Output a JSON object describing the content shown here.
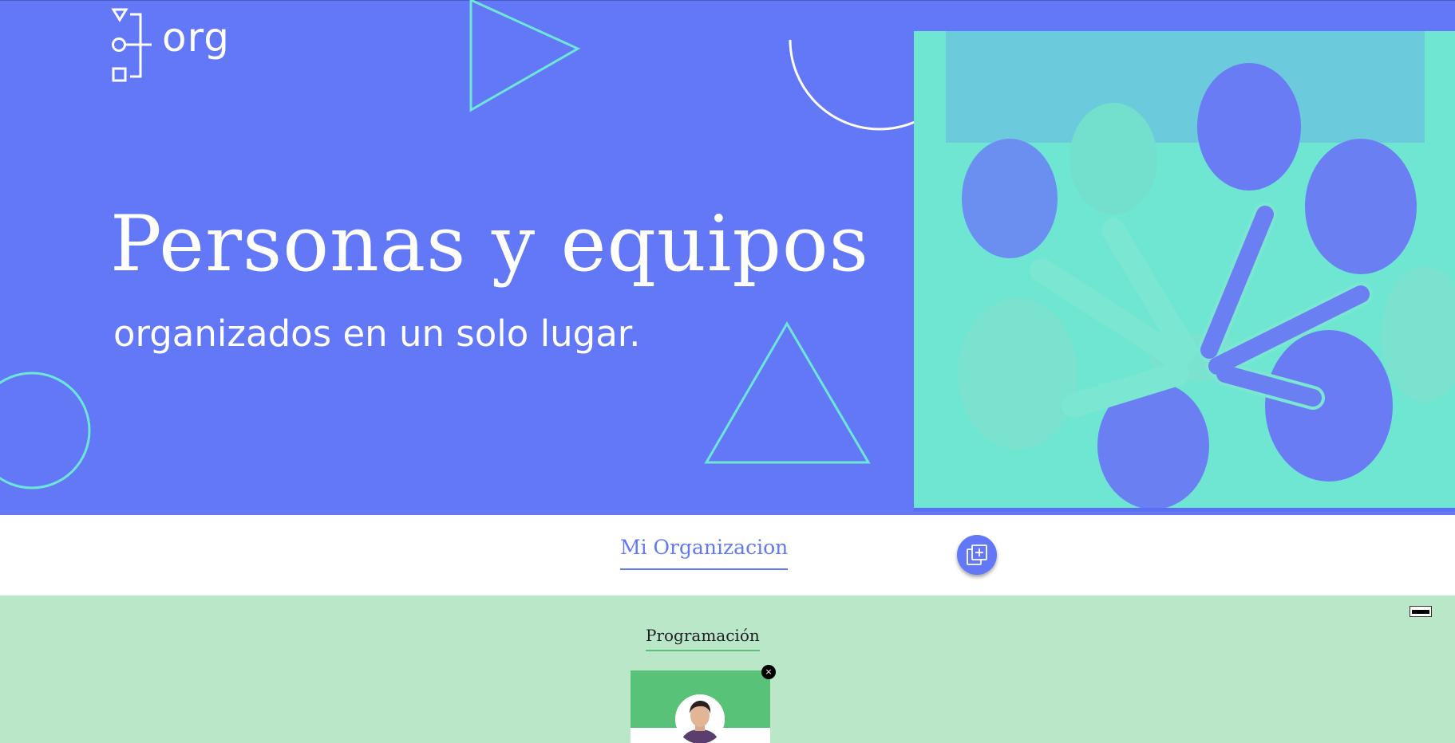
{
  "hero": {
    "logo_text": "org",
    "title": "Personas y equipos",
    "subtitle": "organizados en un solo lugar.",
    "background_color": "#6278f7",
    "shape_accent": "#6ee6d6"
  },
  "nav": {
    "tab_label": "Mi Organizacion",
    "add_button_icon": "add-collection-icon"
  },
  "team": {
    "title": "Programación",
    "background_color": "#bae7c8",
    "accent_color": "#57c278",
    "close_label": "×",
    "toggle_icon": "minimize-icon"
  }
}
